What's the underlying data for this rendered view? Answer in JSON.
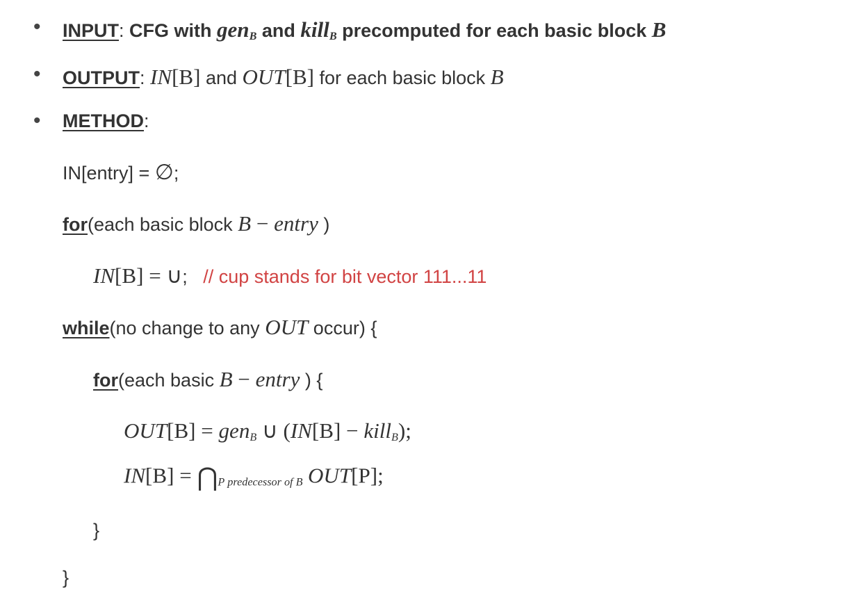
{
  "bullets": {
    "input": {
      "label": "INPUT",
      "text_pre": ": ",
      "text_bold": "CFG with ",
      "gen": "gen",
      "sub_b": "B",
      "and": " and ",
      "kill": "kill",
      "tail": " precomputed for each basic block ",
      "big_b": "B"
    },
    "output": {
      "label": "OUTPUT",
      "colon": ": ",
      "in_b": "IN",
      "bracket_b": "[B]",
      "and": " and ",
      "out_b": "OUT",
      "tail": " for each basic block ",
      "big_b": "B"
    },
    "method": {
      "label": "METHOD",
      "colon": ":"
    }
  },
  "method": {
    "l1_a": "IN[entry] = ",
    "l1_empty": "∅",
    "l1_b": ";",
    "l2_for": "for",
    "l2_text": "(each basic block ",
    "l2_expr_b": "B",
    "l2_minus": " − ",
    "l2_entry": "entry",
    "l2_paren": " )",
    "l3_in": "IN",
    "l3_bracket": "[B] = ",
    "l3_cup": "∪",
    "l3_semi": ";",
    "l3_comment": "// cup stands for bit vector 111...11",
    "l4_while": "while",
    "l4_text_a": "(no change to any ",
    "l4_out": "OUT",
    "l4_text_b": " occur) {",
    "l5_for": "for",
    "l5_text": "(each basic ",
    "l5_b": "B",
    "l5_minus": " − ",
    "l5_entry": "entry",
    "l5_close": " ) {",
    "l6_out": "OUT",
    "l6_br_b": "[B] = ",
    "l6_gen": "gen",
    "l6_sub_b": "B",
    "l6_cup": " ∪ ",
    "l6_paren_open": "(",
    "l6_in": "IN",
    "l6_in_b": "[B]",
    "l6_minus": " − ",
    "l6_kill": "kill",
    "l6_close": ");",
    "l7_in": "IN",
    "l7_br_b": "[B] = ",
    "l7_bigcap": "⋂",
    "l7_sub_p": "P",
    "l7_sub_text": " predecessor of B",
    "l7_sp": " ",
    "l7_out": "OUT",
    "l7_out_p": "[P]",
    "l7_semi": ";",
    "l8_close": "}",
    "l9_close": "}"
  }
}
